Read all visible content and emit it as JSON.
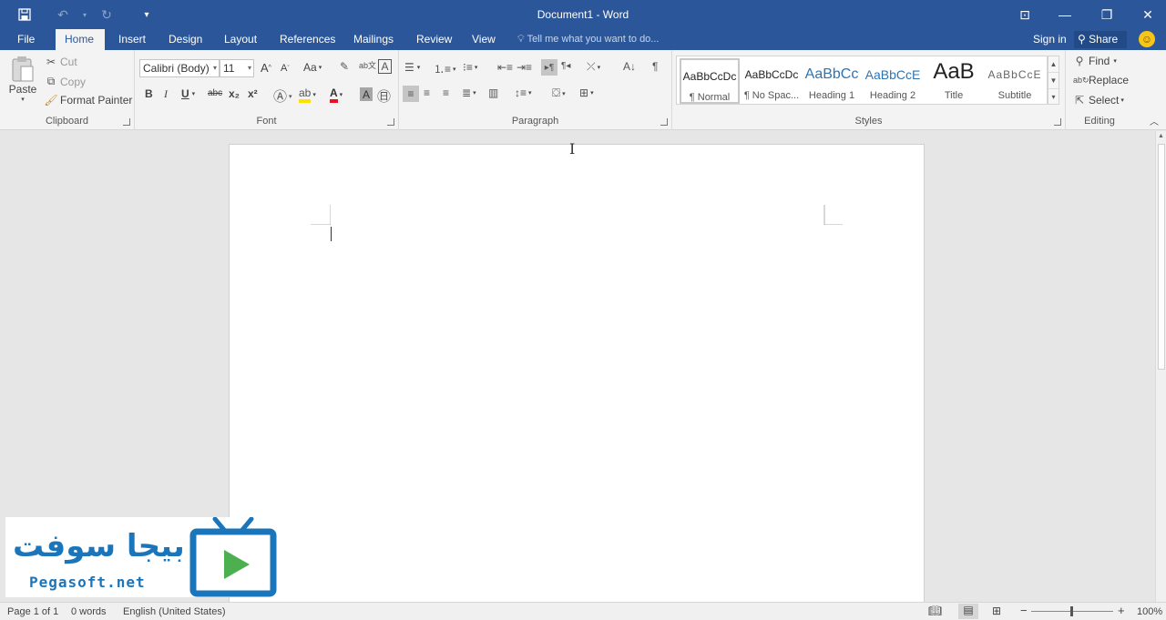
{
  "window": {
    "title": "Document1 - Word",
    "controls": {
      "ribbon_display": "⊡",
      "minimize": "—",
      "restore": "❐",
      "close": "✕"
    }
  },
  "quick_access": {
    "save_icon": "save-icon",
    "undo_icon": "undo-icon",
    "redo_icon": "redo-icon",
    "customize_icon": "customize-icon"
  },
  "tabs": [
    "File",
    "Home",
    "Insert",
    "Design",
    "Layout",
    "References",
    "Mailings",
    "Review",
    "View"
  ],
  "active_tab": "Home",
  "tell_me": "Tell me what you want to do...",
  "account": {
    "sign_in": "Sign in",
    "share": "Share"
  },
  "clipboard": {
    "label": "Clipboard",
    "paste": "Paste",
    "cut": "Cut",
    "copy": "Copy",
    "format_painter": "Format Painter"
  },
  "font": {
    "label": "Font",
    "family": "Calibri (Body)",
    "size": "11",
    "grow": "A",
    "shrink": "A",
    "case": "Aa",
    "bold": "B",
    "italic": "I",
    "underline": "U",
    "strike": "abc",
    "subscript": "x₂",
    "superscript": "x²",
    "font_color": "A",
    "char_shading": "A"
  },
  "paragraph": {
    "label": "Paragraph"
  },
  "styles": {
    "label": "Styles",
    "items": [
      {
        "preview": "AaBbCcDc",
        "name": "¶ Normal"
      },
      {
        "preview": "AaBbCcDc",
        "name": "¶ No Spac..."
      },
      {
        "preview": "AaBbCc",
        "name": "Heading 1"
      },
      {
        "preview": "AaBbCcE",
        "name": "Heading 2"
      },
      {
        "preview": "AaB",
        "name": "Title"
      },
      {
        "preview": "AaBbCcE",
        "name": "Subtitle"
      }
    ]
  },
  "editing": {
    "label": "Editing",
    "find": "Find",
    "replace": "Replace",
    "select": "Select"
  },
  "status": {
    "page": "Page 1 of 1",
    "words": "0 words",
    "language": "English (United States)",
    "zoom": "100%"
  },
  "watermark": {
    "arabic": "بيجا سوفت",
    "site": "Pegasoft.net"
  },
  "colors": {
    "accent": "#2b579a",
    "logo_blue": "#1b75bb",
    "logo_green": "#4caf50",
    "highlight": "#ffe100",
    "font_red": "#e81123"
  }
}
